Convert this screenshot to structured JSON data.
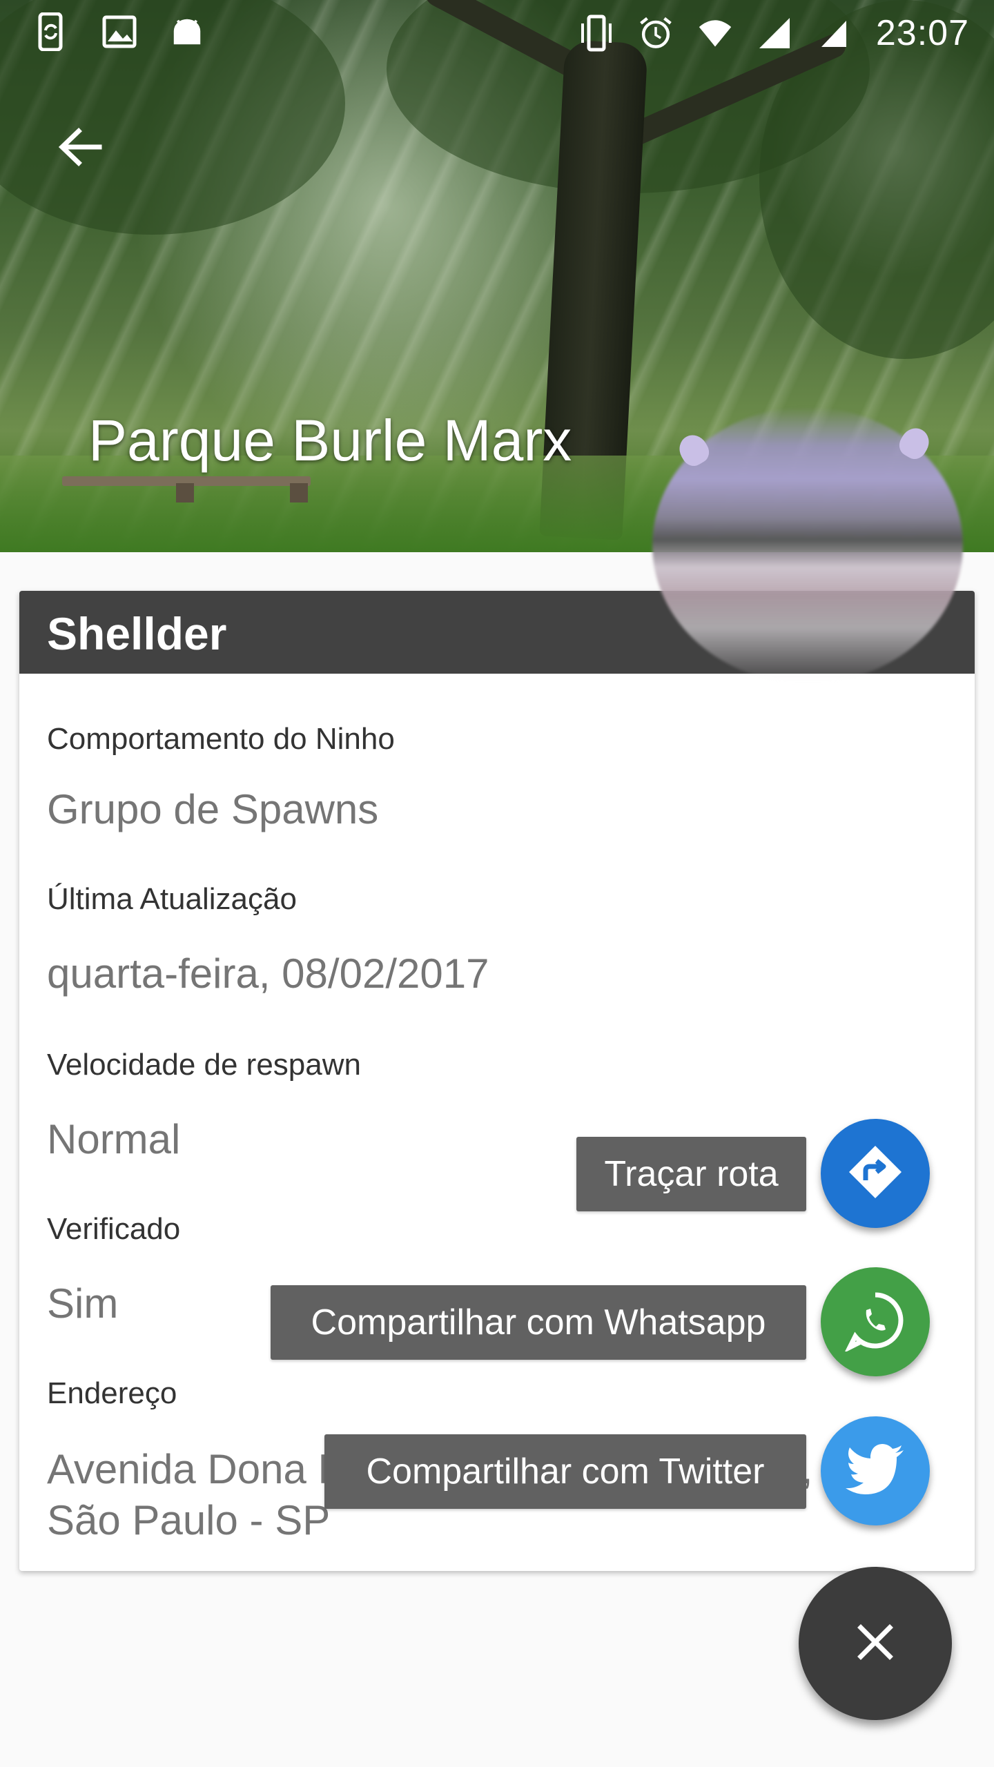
{
  "status_bar": {
    "time": "23:07",
    "left_icons": [
      "phone-sync-icon",
      "image-icon",
      "android-icon"
    ],
    "right_icons": [
      "vibrate-icon",
      "alarm-icon",
      "wifi-icon",
      "signal-icon",
      "battery-icon"
    ]
  },
  "header": {
    "back_icon": "arrow-back-icon",
    "park_name": "Parque Burle Marx"
  },
  "card": {
    "pokemon_name": "Shellder",
    "fields": [
      {
        "label": "Comportamento do Ninho",
        "value": "Grupo de Spawns"
      },
      {
        "label": "Última Atualização",
        "value": "quarta-feira, 08/02/2017"
      },
      {
        "label": "Velocidade de respawn",
        "value": "Normal"
      },
      {
        "label": "Verificado",
        "value": "Sim"
      },
      {
        "label": "Endereço",
        "value_line1": "Avenida Dona Helena Pereira de Moraes,",
        "value_line2": "São Paulo - SP"
      }
    ]
  },
  "fab_menu": {
    "items": [
      {
        "label": "Traçar rota",
        "icon": "directions-icon",
        "color": "#1E74D2"
      },
      {
        "label": "Compartilhar com Whatsapp",
        "icon": "whatsapp-icon",
        "color": "#43A047"
      },
      {
        "label": "Compartilhar com Twitter",
        "icon": "twitter-icon",
        "color": "#3B9BEA"
      }
    ],
    "close_icon": "close-icon",
    "main_color": "#3c3c3c"
  },
  "colors": {
    "card_header": "#424242",
    "label_bg": "#616161",
    "value_text": "#757575"
  }
}
